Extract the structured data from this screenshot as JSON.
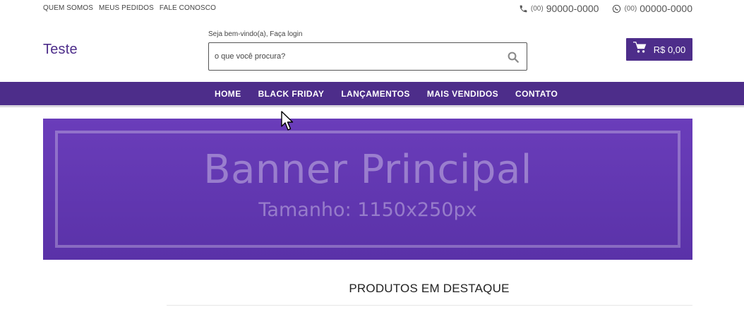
{
  "topbar": {
    "links": [
      "QUEM SOMOS",
      "MEUS PEDIDOS",
      "FALE CONOSCO"
    ],
    "phone": {
      "ddd": "(00)",
      "number": "90000-0000",
      "icon": "phone-icon"
    },
    "whatsapp": {
      "ddd": "(00)",
      "number": "00000-0000",
      "icon": "whatsapp-icon"
    }
  },
  "header": {
    "logo": "Teste",
    "welcome": "Seja bem-vindo(a), Faça login",
    "search_placeholder": "o que você procura?",
    "search_icon": "search-icon",
    "cart_icon": "cart-icon",
    "cart_total": "R$ 0,00"
  },
  "nav": {
    "items": [
      "HOME",
      "BLACK FRIDAY",
      "LANÇAMENTOS",
      "MAIS VENDIDOS",
      "CONTATO"
    ]
  },
  "banner": {
    "title": "Banner Principal",
    "subtitle": "Tamanho: 1150x250px"
  },
  "featured": {
    "title": "PRODUTOS EM DESTAQUE"
  },
  "colors": {
    "brand": "#4d2d8a",
    "banner": "#6a3dba"
  }
}
